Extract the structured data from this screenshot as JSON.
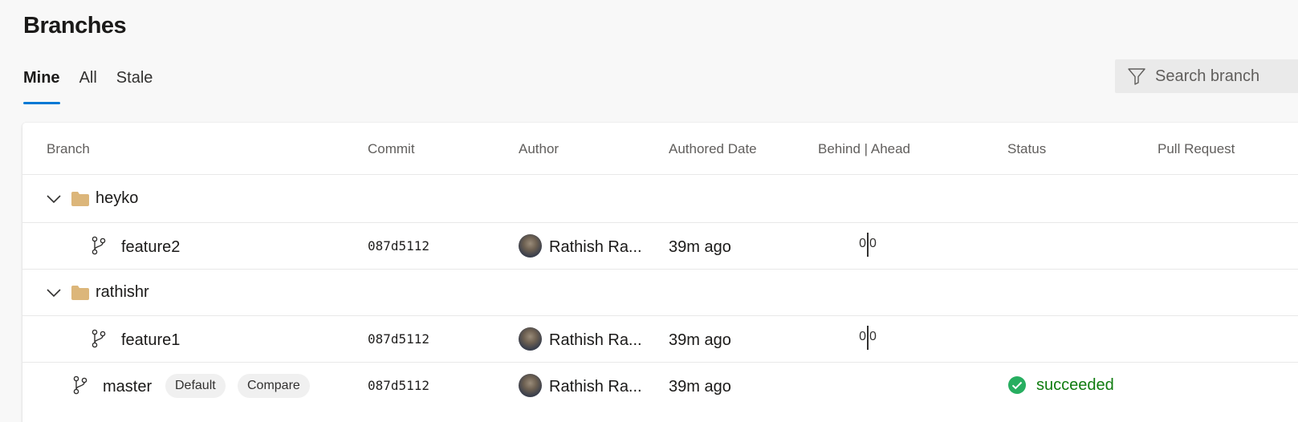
{
  "page": {
    "title": "Branches"
  },
  "tabs": [
    {
      "label": "Mine",
      "active": true
    },
    {
      "label": "All",
      "active": false
    },
    {
      "label": "Stale",
      "active": false
    }
  ],
  "search": {
    "placeholder": "Search branch"
  },
  "table": {
    "columns": [
      "Branch",
      "Commit",
      "Author",
      "Authored Date",
      "Behind | Ahead",
      "Status",
      "Pull Request"
    ],
    "groups": [
      {
        "name": "heyko",
        "branches": [
          {
            "name": "feature2",
            "commit": "087d5112",
            "author": "Rathish Ra...",
            "date": "39m ago",
            "behind": "0",
            "ahead": "0"
          }
        ]
      },
      {
        "name": "rathishr",
        "branches": [
          {
            "name": "feature1",
            "commit": "087d5112",
            "author": "Rathish Ra...",
            "date": "39m ago",
            "behind": "0",
            "ahead": "0"
          }
        ]
      }
    ],
    "master": {
      "name": "master",
      "default_label": "Default",
      "compare_label": "Compare",
      "commit": "087d5112",
      "author": "Rathish Ra...",
      "date": "39m ago",
      "status": "succeeded"
    }
  },
  "colors": {
    "accent": "#0078d4",
    "success": "#107c10",
    "folder": "#dcb67a"
  },
  "icons": {
    "filter": "filter-icon",
    "chevron": "chevron-down-icon",
    "folder": "folder-icon",
    "branch": "git-branch-icon",
    "status": "check-circle-icon"
  }
}
